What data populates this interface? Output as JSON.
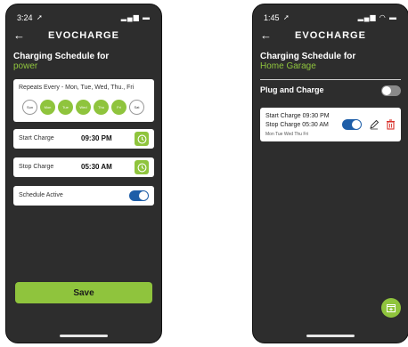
{
  "left_screen": {
    "status_time": "3:24",
    "header": {
      "title": "EVOCHARGE"
    },
    "title": "Charging Schedule for",
    "subtitle": "power",
    "repeat_text": "Repeats Every - Mon, Tue, Wed, Thu., Fri",
    "days": [
      {
        "label": "Sun",
        "active": false
      },
      {
        "label": "Mon",
        "active": true
      },
      {
        "label": "Tue",
        "active": true
      },
      {
        "label": "Wed",
        "active": true
      },
      {
        "label": "Thu",
        "active": true
      },
      {
        "label": "Fri",
        "active": true
      },
      {
        "label": "Sat",
        "active": false
      }
    ],
    "start_charge": {
      "label": "Start Charge",
      "time": "09:30 PM"
    },
    "stop_charge": {
      "label": "Stop Charge",
      "time": "05:30 AM"
    },
    "schedule_active": {
      "label": "Schedule Active",
      "enabled": true
    },
    "save_label": "Save"
  },
  "right_screen": {
    "status_time": "1:45",
    "header": {
      "title": "EVOCHARGE"
    },
    "title": "Charging Schedule for",
    "subtitle": "Home Garage",
    "plug_and_charge": {
      "label": "Plug and Charge",
      "enabled": false
    },
    "schedule": {
      "start_line": "Start Charge 09:30 PM",
      "stop_line": "Stop Charge 05:30 AM",
      "days": "Mon Tue Wed Thu Fri",
      "enabled": true
    }
  },
  "colors": {
    "background": "#2d2d2d",
    "accent_green": "#8fc43d",
    "toggle_blue": "#1e5ea8",
    "delete_red": "#d9312b"
  },
  "icons": [
    "back-arrow-icon",
    "location-arrow-icon",
    "signal-icon",
    "wifi-icon",
    "battery-icon",
    "clock-icon",
    "edit-pencil-icon",
    "trash-icon",
    "add-schedule-icon"
  ]
}
